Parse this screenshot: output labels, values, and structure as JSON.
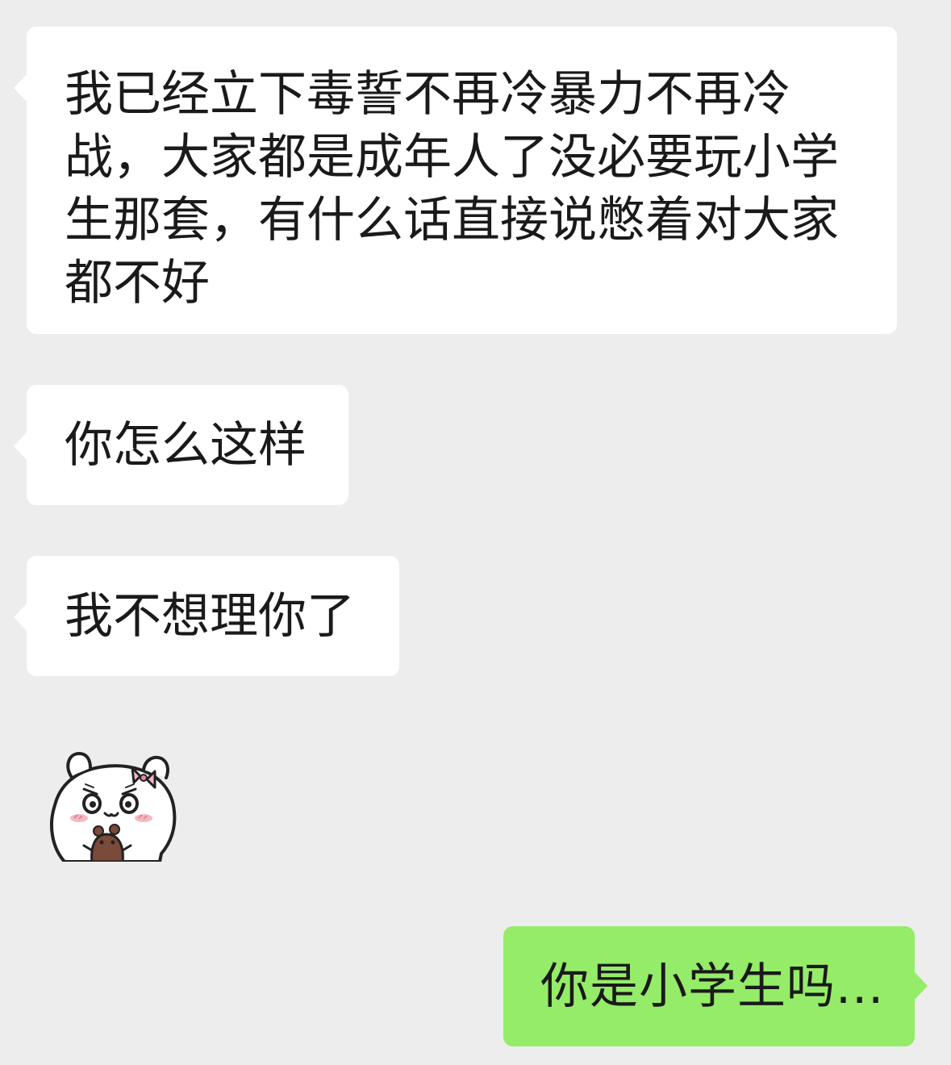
{
  "chat": {
    "messages": [
      {
        "id": "msg1",
        "side": "incoming",
        "type": "text",
        "text": "我已经立下毒誓不再冷暴力不再冷战，大家都是成年人了没必要玩小学生那套，有什么话直接说憋着对大家都不好"
      },
      {
        "id": "msg2",
        "side": "incoming",
        "type": "text",
        "text": "你怎么这样"
      },
      {
        "id": "msg3",
        "side": "incoming",
        "type": "text",
        "text": "我不想理你了"
      },
      {
        "id": "msg4",
        "side": "incoming",
        "type": "sticker",
        "icon": "hamster-sticker-icon"
      },
      {
        "id": "msg5",
        "side": "outgoing",
        "type": "text",
        "text": "你是小学生吗..."
      }
    ]
  },
  "colors": {
    "background": "#ededed",
    "incoming_bubble": "#ffffff",
    "outgoing_bubble": "#95ec69",
    "text": "#1a1a1a"
  }
}
